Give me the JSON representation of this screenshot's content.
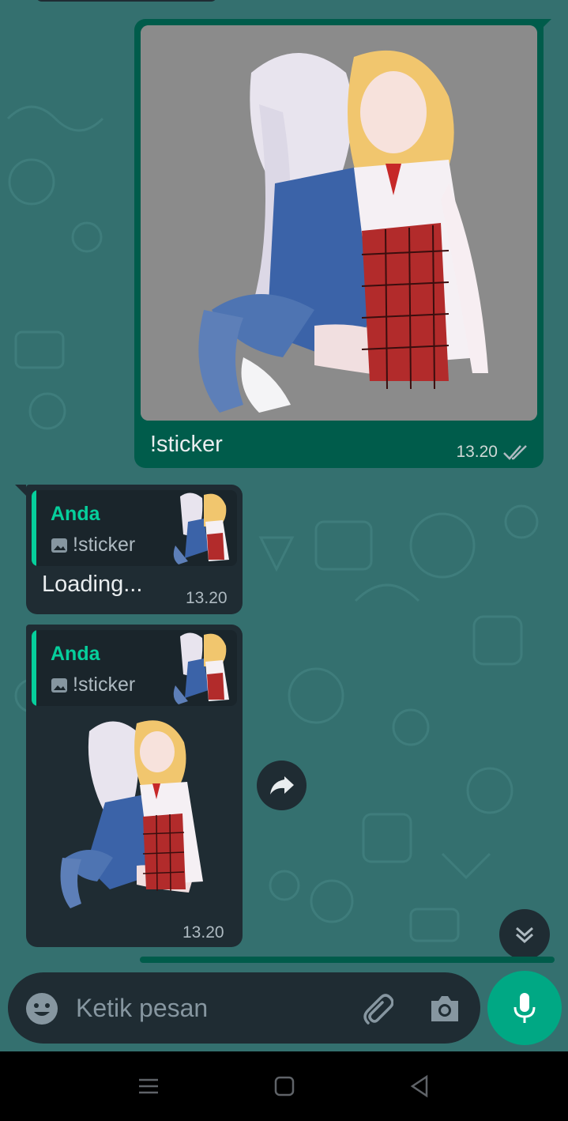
{
  "outgoing": {
    "caption": "!sticker",
    "time": "13.20",
    "status_icon": "double-check-icon"
  },
  "reply1": {
    "quote_name": "Anda",
    "quote_text": "!sticker",
    "text": "Loading...",
    "time": "13.20"
  },
  "reply2": {
    "quote_name": "Anda",
    "quote_text": "!sticker",
    "time": "13.20"
  },
  "composer": {
    "placeholder": "Ketik pesan",
    "icons": [
      "emoji-icon",
      "attach-icon",
      "camera-icon",
      "mic-icon"
    ]
  },
  "colors": {
    "outgoing_bubble": "#005c4b",
    "incoming_bubble": "#1f2c33",
    "accent": "#06cf9c",
    "mic": "#00a884"
  }
}
